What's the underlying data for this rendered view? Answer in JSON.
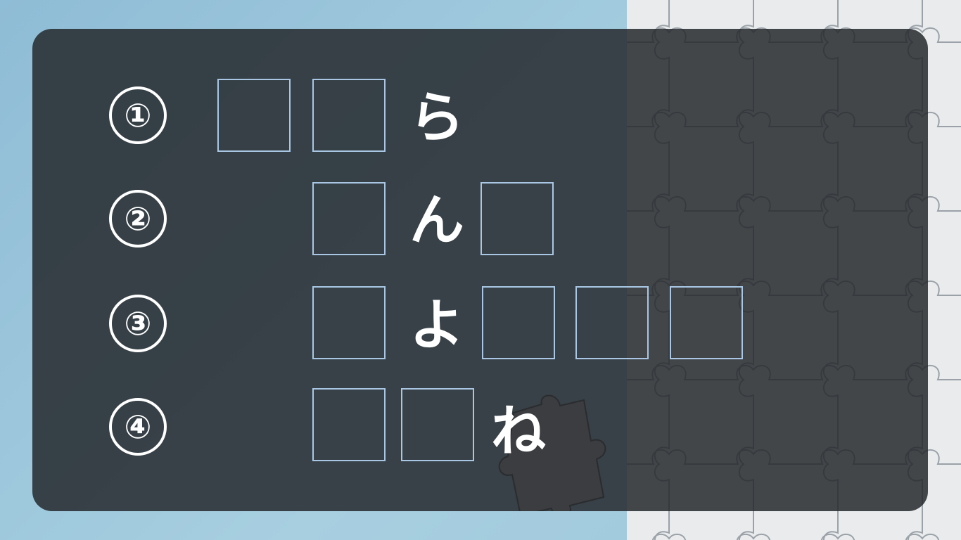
{
  "colors": {
    "background": "#9ec7db",
    "panel": "#23262a",
    "blank_border": "#a9c7e4",
    "text": "#ffffff",
    "puzzle_board": "#e9ebed"
  },
  "images": {
    "background": "jigsaw-puzzle-icon"
  },
  "quiz": {
    "rows": [
      {
        "number": "①",
        "blank_count": 2,
        "kana": "ら"
      },
      {
        "number": "②",
        "blank_count": 2,
        "kana": "ん"
      },
      {
        "number": "③",
        "blank_count": 4,
        "kana": "よ"
      },
      {
        "number": "④",
        "blank_count": 2,
        "kana": "ね"
      }
    ]
  }
}
